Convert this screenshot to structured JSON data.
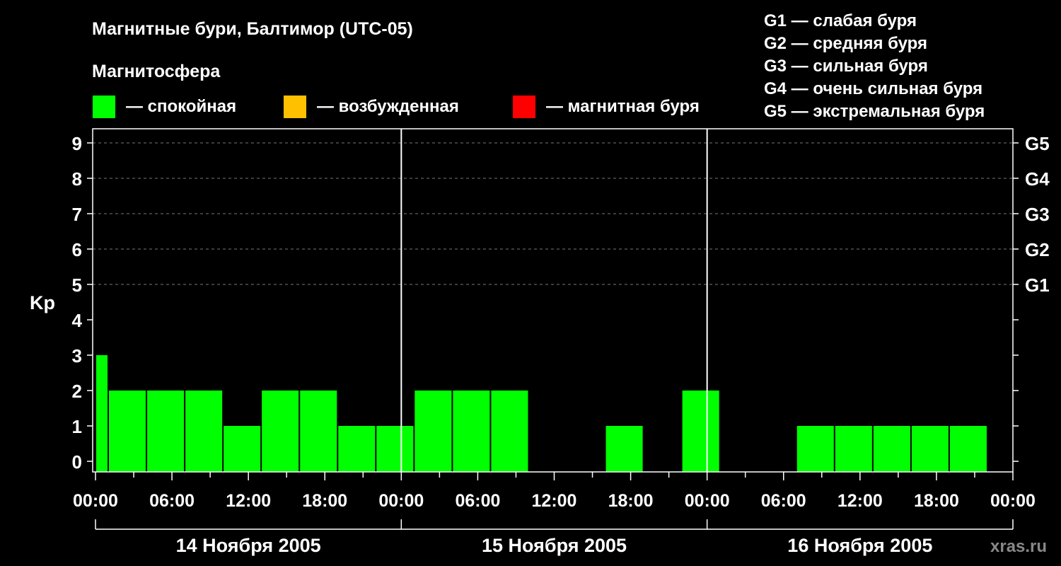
{
  "title": "Магнитные бури, Балтимор (UTC-05)",
  "legend": {
    "heading": "Магнитосфера",
    "items": [
      {
        "label": "— спокойная",
        "color": "#00ff00"
      },
      {
        "label": "— возбужденная",
        "color": "#ffc000"
      },
      {
        "label": "— магнитная буря",
        "color": "#ff0000"
      }
    ]
  },
  "g_scale": [
    "G1 — слабая буря",
    "G2 — средняя буря",
    "G3 — сильная буря",
    "G4 — очень сильная буря",
    "G5 — экстремальная буря"
  ],
  "watermark": "xras.ru",
  "chart_data": {
    "type": "bar",
    "ylabel": "Kp",
    "ylim": [
      0,
      9
    ],
    "yticks": [
      "0",
      "1",
      "2",
      "3",
      "4",
      "5",
      "6",
      "7",
      "8",
      "9"
    ],
    "right_ticks": [
      {
        "kp": 5,
        "label": "G1"
      },
      {
        "kp": 6,
        "label": "G2"
      },
      {
        "kp": 7,
        "label": "G3"
      },
      {
        "kp": 8,
        "label": "G4"
      },
      {
        "kp": 9,
        "label": "G5"
      }
    ],
    "grid": "dashed horizontal at Kp 5-9",
    "xtick_labels": [
      "00:00",
      "06:00",
      "12:00",
      "18:00",
      "00:00",
      "06:00",
      "12:00",
      "18:00",
      "00:00",
      "06:00",
      "12:00",
      "18:00",
      "00:00"
    ],
    "days": [
      "14 Ноября 2005",
      "15 Ноября 2005",
      "16 Ноября 2005"
    ],
    "bars": [
      {
        "start_hour": 0,
        "end_hour": 1,
        "kp": 3
      },
      {
        "start_hour": 1,
        "end_hour": 4,
        "kp": 2
      },
      {
        "start_hour": 4,
        "end_hour": 7,
        "kp": 2
      },
      {
        "start_hour": 7,
        "end_hour": 10,
        "kp": 2
      },
      {
        "start_hour": 10,
        "end_hour": 13,
        "kp": 1
      },
      {
        "start_hour": 13,
        "end_hour": 16,
        "kp": 2
      },
      {
        "start_hour": 16,
        "end_hour": 19,
        "kp": 2
      },
      {
        "start_hour": 19,
        "end_hour": 22,
        "kp": 1
      },
      {
        "start_hour": 22,
        "end_hour": 25,
        "kp": 1
      },
      {
        "start_hour": 25,
        "end_hour": 28,
        "kp": 2
      },
      {
        "start_hour": 28,
        "end_hour": 31,
        "kp": 2
      },
      {
        "start_hour": 31,
        "end_hour": 34,
        "kp": 2
      },
      {
        "start_hour": 34,
        "end_hour": 37,
        "kp": 0
      },
      {
        "start_hour": 37,
        "end_hour": 40,
        "kp": 0
      },
      {
        "start_hour": 40,
        "end_hour": 43,
        "kp": 1
      },
      {
        "start_hour": 43,
        "end_hour": 46,
        "kp": 0
      },
      {
        "start_hour": 46,
        "end_hour": 49,
        "kp": 2
      },
      {
        "start_hour": 49,
        "end_hour": 52,
        "kp": 0
      },
      {
        "start_hour": 52,
        "end_hour": 55,
        "kp": 0
      },
      {
        "start_hour": 55,
        "end_hour": 58,
        "kp": 1
      },
      {
        "start_hour": 58,
        "end_hour": 61,
        "kp": 1
      },
      {
        "start_hour": 61,
        "end_hour": 64,
        "kp": 1
      },
      {
        "start_hour": 64,
        "end_hour": 67,
        "kp": 1
      },
      {
        "start_hour": 67,
        "end_hour": 70,
        "kp": 1
      }
    ],
    "bar_color": "#00ff00",
    "day_separators": "white vertical lines at 00:00"
  }
}
